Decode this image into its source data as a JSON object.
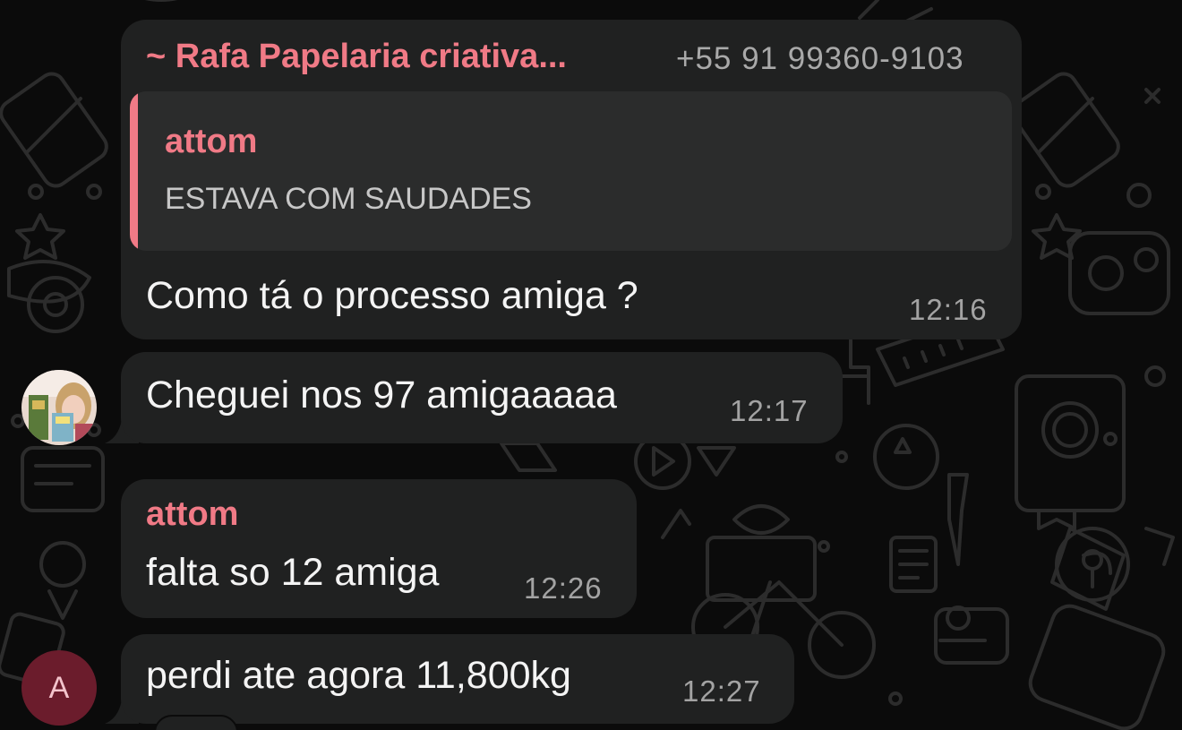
{
  "colors": {
    "background": "#0b0b0b",
    "bubble": "#202121",
    "quote_background": "#2b2c2c",
    "sender_name": "#f07a86",
    "timestamp": "#a3a3a3",
    "avatar_letter_bg": "#6b1c2c"
  },
  "messages": [
    {
      "sender_name": "~ Rafa Papelaria criativa...",
      "sender_phone": "+55 91 99360-9103",
      "reply": {
        "author": "attom",
        "text": "ESTAVA COM SAUDADES"
      },
      "text": "Como tá o processo amiga ?",
      "time": "12:16"
    },
    {
      "avatar": "photo-avatar",
      "text": "Cheguei nos 97 amigaaaaa",
      "time": "12:17"
    },
    {
      "sender_name": "attom",
      "text": "falta so 12 amiga",
      "time": "12:26"
    },
    {
      "avatar_letter": "A",
      "text": "perdi ate agora 11,800kg",
      "time": "12:27"
    }
  ]
}
